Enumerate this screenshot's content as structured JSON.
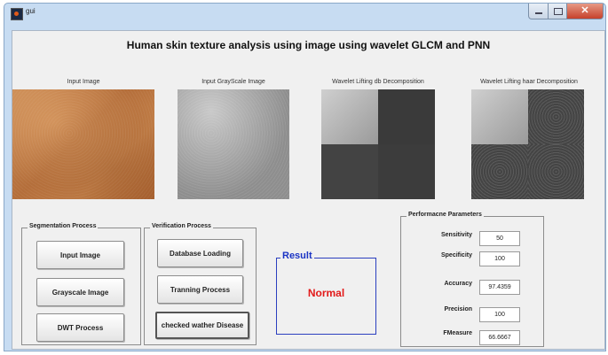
{
  "window": {
    "title": "gui",
    "close_glyph": "✕"
  },
  "page_title": "Human skin texture analysis using image using wavelet  GLCM and PNN",
  "images": [
    {
      "label": "Input Image"
    },
    {
      "label": "Input GrayScale Image"
    },
    {
      "label": "Wavelet Lifting db Decomposition"
    },
    {
      "label": "Wavelet Lifting haar Decomposition"
    }
  ],
  "segmentation": {
    "title": "Segmentation Process",
    "buttons": [
      "Input Image",
      "Grayscale Image",
      "DWT Process"
    ]
  },
  "verification": {
    "title": "Verification Process",
    "buttons": [
      "Database Loading",
      "Tranning Process",
      "checked wather Disease"
    ]
  },
  "result": {
    "title": "Result",
    "value": "Normal",
    "value_color": "#e21a1a"
  },
  "performance": {
    "title": "Performacne Parameters",
    "rows": [
      {
        "label": "Sensitivity",
        "value": "50"
      },
      {
        "label": "Specificity",
        "value": "100"
      },
      {
        "label": "Accuracy",
        "value": "97.4359"
      },
      {
        "label": "Precision",
        "value": "100"
      },
      {
        "label": "FMeasure",
        "value": "66.6667"
      }
    ]
  },
  "icons": {
    "app": "matlab-figure-icon",
    "minimize": "minimize-icon",
    "maximize": "maximize-icon",
    "close": "close-icon"
  }
}
